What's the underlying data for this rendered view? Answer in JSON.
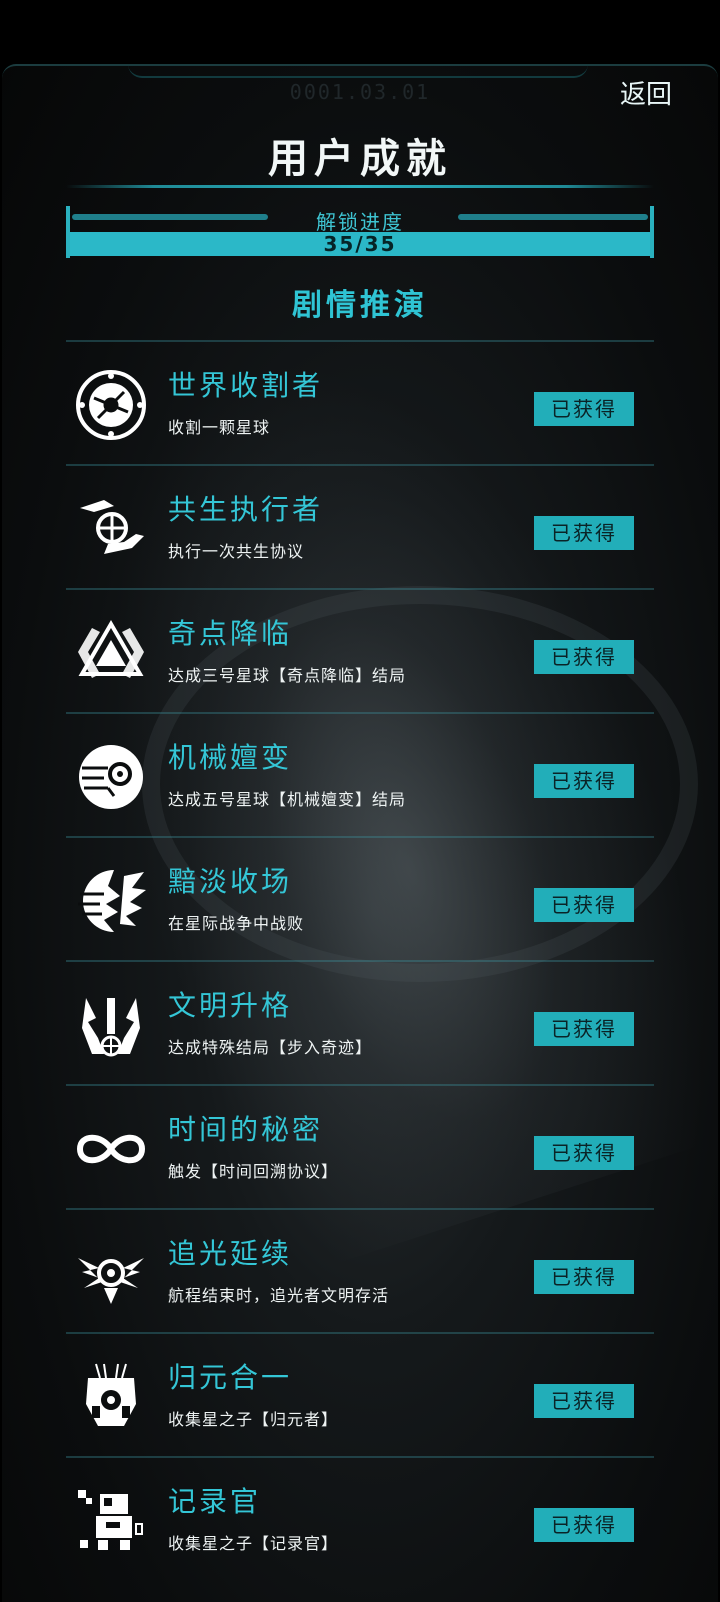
{
  "header": {
    "serial": "0001.03.01",
    "back_label": "返回",
    "title": "用户成就"
  },
  "progress": {
    "label": "解锁进度",
    "value_text": "35/35",
    "fraction": 1.0
  },
  "section": {
    "title": "剧情推演"
  },
  "colors": {
    "accent": "#2bb8c8",
    "title_cyan": "#34c6d6",
    "background": "#0b0d0e"
  },
  "achievements": [
    {
      "name": "世界收割者",
      "desc": "收割一颗星球",
      "status": "已获得",
      "icon": "harvested-planet-icon"
    },
    {
      "name": "共生执行者",
      "desc": "执行一次共生协议",
      "status": "已获得",
      "icon": "globe-in-hand-icon"
    },
    {
      "name": "奇点降临",
      "desc": "达成三号星球【奇点降临】结局",
      "status": "已获得",
      "icon": "singularity-triangle-icon"
    },
    {
      "name": "机械嬗变",
      "desc": "达成五号星球【机械嬗变】结局",
      "status": "已获得",
      "icon": "mechanical-orb-icon"
    },
    {
      "name": "黯淡收场",
      "desc": "在星际战争中战败",
      "status": "已获得",
      "icon": "shattered-planet-icon"
    },
    {
      "name": "文明升格",
      "desc": "达成特殊结局【步入奇迹】",
      "status": "已获得",
      "icon": "winged-emblem-icon"
    },
    {
      "name": "时间的秘密",
      "desc": "触发【时间回溯协议】",
      "status": "已获得",
      "icon": "infinity-icon"
    },
    {
      "name": "追光延续",
      "desc": "航程结束时，追光者文明存活",
      "status": "已获得",
      "icon": "winged-sun-icon"
    },
    {
      "name": "归元合一",
      "desc": "收集星之子【归元者】",
      "status": "已获得",
      "icon": "robot-mask-icon"
    },
    {
      "name": "记录官",
      "desc": "收集星之子【记录官】",
      "status": "已获得",
      "icon": "pixel-robot-icon"
    }
  ]
}
